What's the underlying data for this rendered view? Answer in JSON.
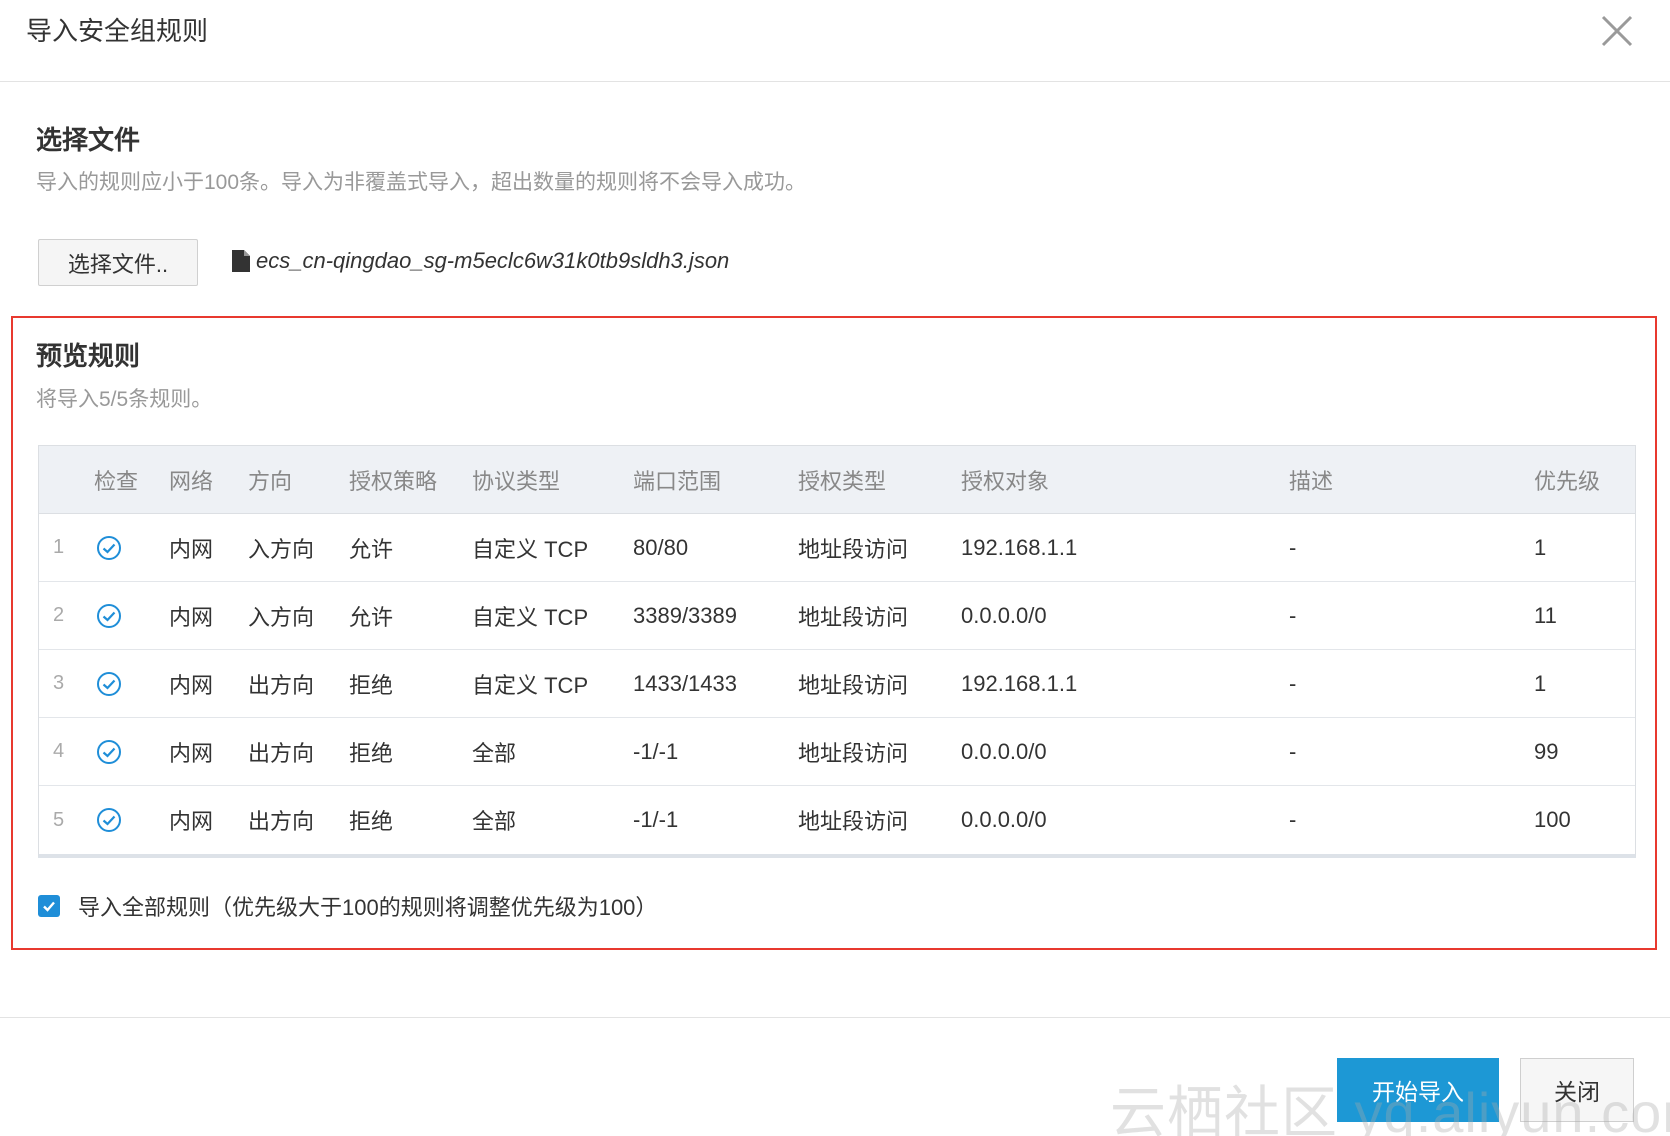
{
  "dialog": {
    "title": "导入安全组规则",
    "close_icon": "close-icon"
  },
  "select_file": {
    "title": "选择文件",
    "description": "导入的规则应小于100条。导入为非覆盖式导入，超出数量的规则将不会导入成功。",
    "button_label": "选择文件..",
    "file_icon": "file-icon",
    "file_name": "ecs_cn-qingdao_sg-m5eclc6w31k0tb9sldh3.json"
  },
  "preview": {
    "title": "预览规则",
    "description": "将导入5/5条规则。",
    "columns": [
      "检查",
      "网络",
      "方向",
      "授权策略",
      "协议类型",
      "端口范围",
      "授权类型",
      "授权对象",
      "描述",
      "优先级"
    ],
    "rows": [
      {
        "index": "1",
        "network": "内网",
        "direction": "入方向",
        "policy": "允许",
        "protocol": "自定义 TCP",
        "port": "80/80",
        "auth_type": "地址段访问",
        "auth_object": "192.168.1.1",
        "description": "-",
        "priority": "1"
      },
      {
        "index": "2",
        "network": "内网",
        "direction": "入方向",
        "policy": "允许",
        "protocol": "自定义 TCP",
        "port": "3389/3389",
        "auth_type": "地址段访问",
        "auth_object": "0.0.0.0/0",
        "description": "-",
        "priority": "11"
      },
      {
        "index": "3",
        "network": "内网",
        "direction": "出方向",
        "policy": "拒绝",
        "protocol": "自定义 TCP",
        "port": "1433/1433",
        "auth_type": "地址段访问",
        "auth_object": "192.168.1.1",
        "description": "-",
        "priority": "1"
      },
      {
        "index": "4",
        "network": "内网",
        "direction": "出方向",
        "policy": "拒绝",
        "protocol": "全部",
        "port": "-1/-1",
        "auth_type": "地址段访问",
        "auth_object": "0.0.0.0/0",
        "description": "-",
        "priority": "99"
      },
      {
        "index": "5",
        "network": "内网",
        "direction": "出方向",
        "policy": "拒绝",
        "protocol": "全部",
        "port": "-1/-1",
        "auth_type": "地址段访问",
        "auth_object": "0.0.0.0/0",
        "description": "-",
        "priority": "100"
      }
    ],
    "check_icon": "check-circle-icon",
    "import_all_checked": true,
    "import_all_label": "导入全部规则（优先级大于100的规则将调整优先级为100）"
  },
  "footer": {
    "start_button": "开始导入",
    "close_button": "关闭"
  },
  "watermark": "云栖社区 yq.aliyun.com",
  "colors": {
    "primary": "#1d98d5",
    "highlight_border": "#e8392f",
    "check": "#1f8ed8"
  }
}
